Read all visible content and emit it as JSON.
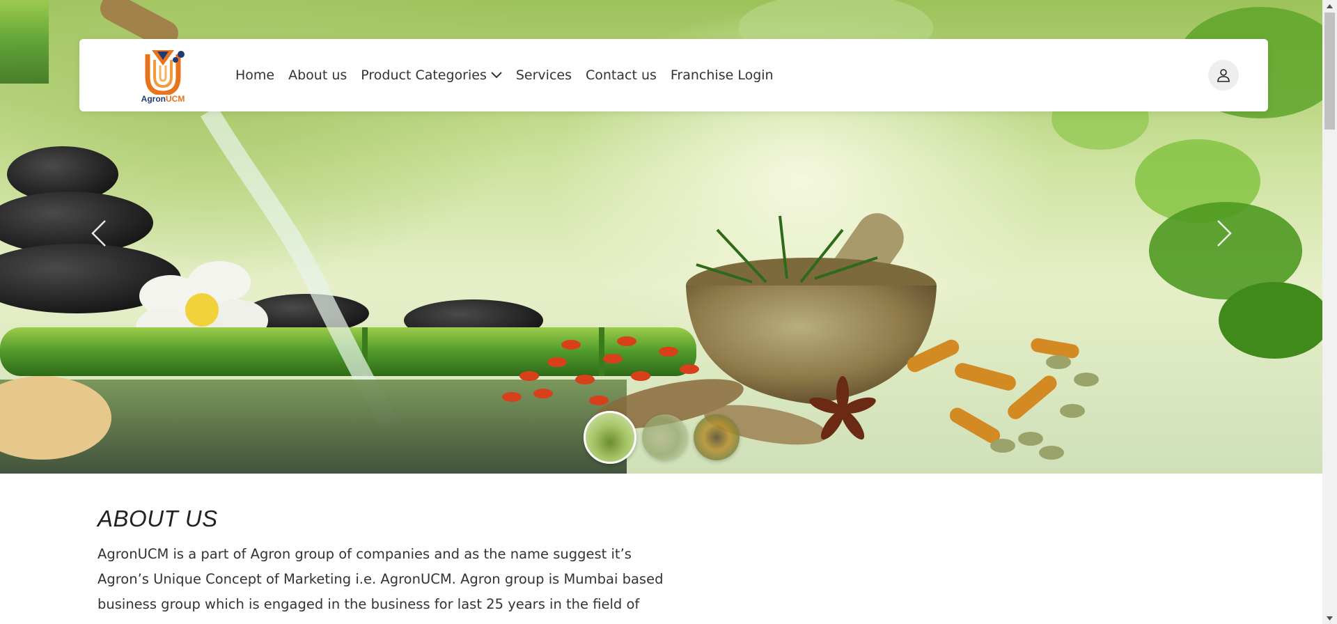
{
  "brand": {
    "logo_main": "Agron",
    "logo_accent": "UCM",
    "logo_icon": "agronucm-logo-icon"
  },
  "nav": {
    "items": [
      {
        "label": "Home"
      },
      {
        "label": "About us"
      },
      {
        "label": "Product Categories",
        "icon": "chevron-down-icon"
      },
      {
        "label": "Services"
      },
      {
        "label": "Contact us"
      },
      {
        "label": "Franchise Login"
      }
    ],
    "profile_icon": "user-icon"
  },
  "hero": {
    "prev_icon": "chevron-left-icon",
    "next_icon": "chevron-right-icon",
    "slides": [
      {
        "name": "slide-1",
        "active": true
      },
      {
        "name": "slide-2",
        "active": false
      },
      {
        "name": "slide-3",
        "active": false
      }
    ]
  },
  "about": {
    "title": "ABOUT US",
    "lines": [
      "AgronUCM is a part of Agron group of companies and as the name suggest it’s",
      "Agron’s Unique Concept of Marketing i.e. AgronUCM. Agron group is Mumbai based",
      "business group which is engaged in the business for last 25 years in the field of"
    ]
  },
  "colors": {
    "brand_orange": "#e8731c",
    "brand_blue": "#1f3a78",
    "nav_text": "#333333"
  }
}
